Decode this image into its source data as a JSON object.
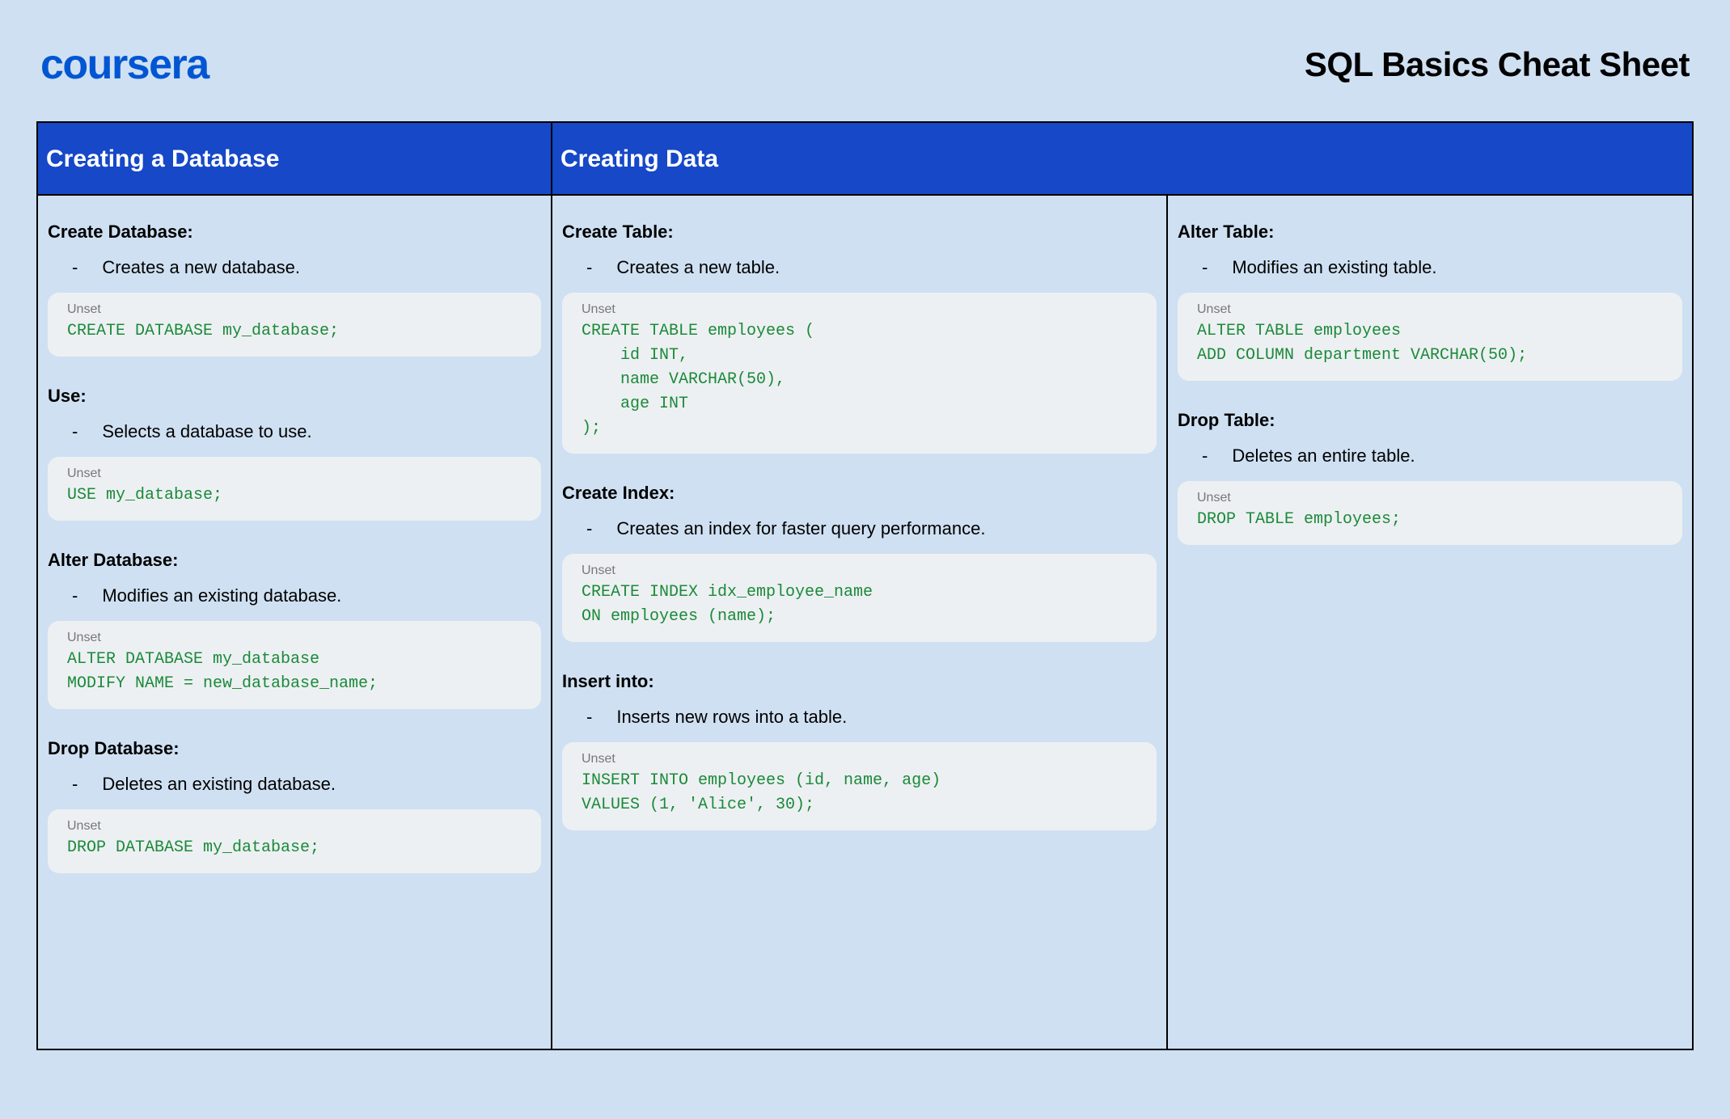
{
  "header": {
    "logo": "coursera",
    "title": "SQL Basics Cheat Sheet"
  },
  "tableHeaders": {
    "left": "Creating a Database",
    "right": "Creating Data"
  },
  "codeLabel": "Unset",
  "col1": [
    {
      "title": "Create Database:",
      "desc": "Creates a new database.",
      "code": "CREATE DATABASE my_database;"
    },
    {
      "title": "Use:",
      "desc": "Selects a database to use.",
      "code": "USE my_database;"
    },
    {
      "title": "Alter Database:",
      "desc": "Modifies an existing database.",
      "code": "ALTER DATABASE my_database\nMODIFY NAME = new_database_name;"
    },
    {
      "title": "Drop Database:",
      "desc": "Deletes an existing database.",
      "code": "DROP DATABASE my_database;"
    }
  ],
  "col2": [
    {
      "title": "Create Table:",
      "desc": "Creates a new table.",
      "code": "CREATE TABLE employees (\n    id INT,\n    name VARCHAR(50),\n    age INT\n);"
    },
    {
      "title": "Create Index:",
      "desc": "Creates an index for faster query performance.",
      "code": "CREATE INDEX idx_employee_name\nON employees (name);"
    },
    {
      "title": "Insert into:",
      "desc": "Inserts new rows into a table.",
      "code": "INSERT INTO employees (id, name, age)\nVALUES (1, 'Alice', 30);"
    }
  ],
  "col3": [
    {
      "title": "Alter Table:",
      "desc": "Modifies an existing table.",
      "code": "ALTER TABLE employees\nADD COLUMN department VARCHAR(50);"
    },
    {
      "title": "Drop Table:",
      "desc": "Deletes an entire table.",
      "code": "DROP TABLE employees;"
    }
  ]
}
